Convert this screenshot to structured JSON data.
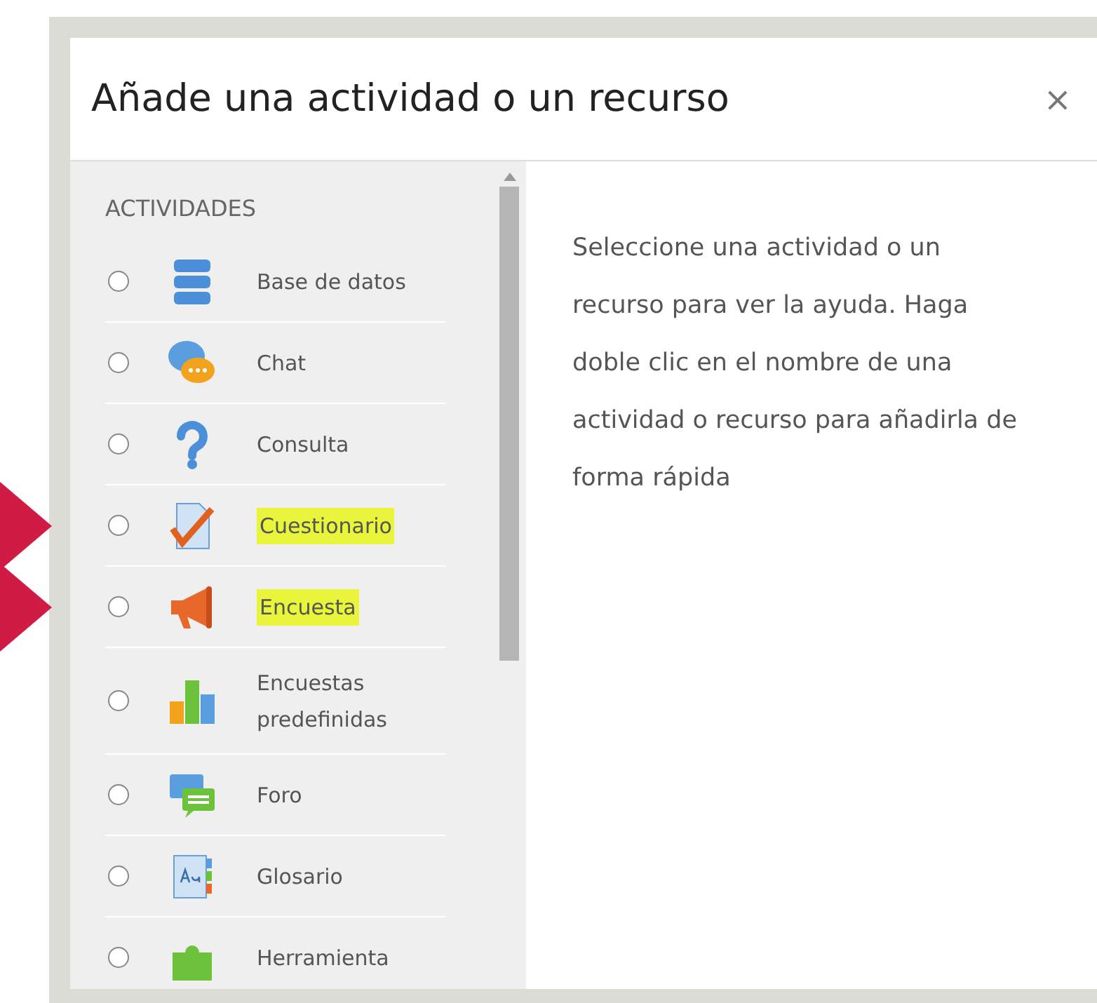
{
  "dialog": {
    "title": "Añade una actividad o un recurso",
    "close": "×"
  },
  "list": {
    "heading": "ACTIVIDADES",
    "items": [
      {
        "label": "Base de datos",
        "selected": false,
        "highlighted": false
      },
      {
        "label": "Chat",
        "selected": false,
        "highlighted": false
      },
      {
        "label": "Consulta",
        "selected": false,
        "highlighted": false
      },
      {
        "label": "Cuestionario",
        "selected": false,
        "highlighted": true
      },
      {
        "label": "Encuesta",
        "selected": false,
        "highlighted": true
      },
      {
        "label": "Encuestas predefinidas",
        "selected": false,
        "highlighted": false
      },
      {
        "label": "Foro",
        "selected": false,
        "highlighted": false
      },
      {
        "label": "Glosario",
        "selected": false,
        "highlighted": false
      },
      {
        "label": "Herramienta",
        "selected": false,
        "highlighted": false
      }
    ]
  },
  "help": {
    "text": "Seleccione una actividad o un recurso para ver la ayuda. Haga doble clic en el nombre de una actividad o recurso para añadirla de forma rápida"
  }
}
